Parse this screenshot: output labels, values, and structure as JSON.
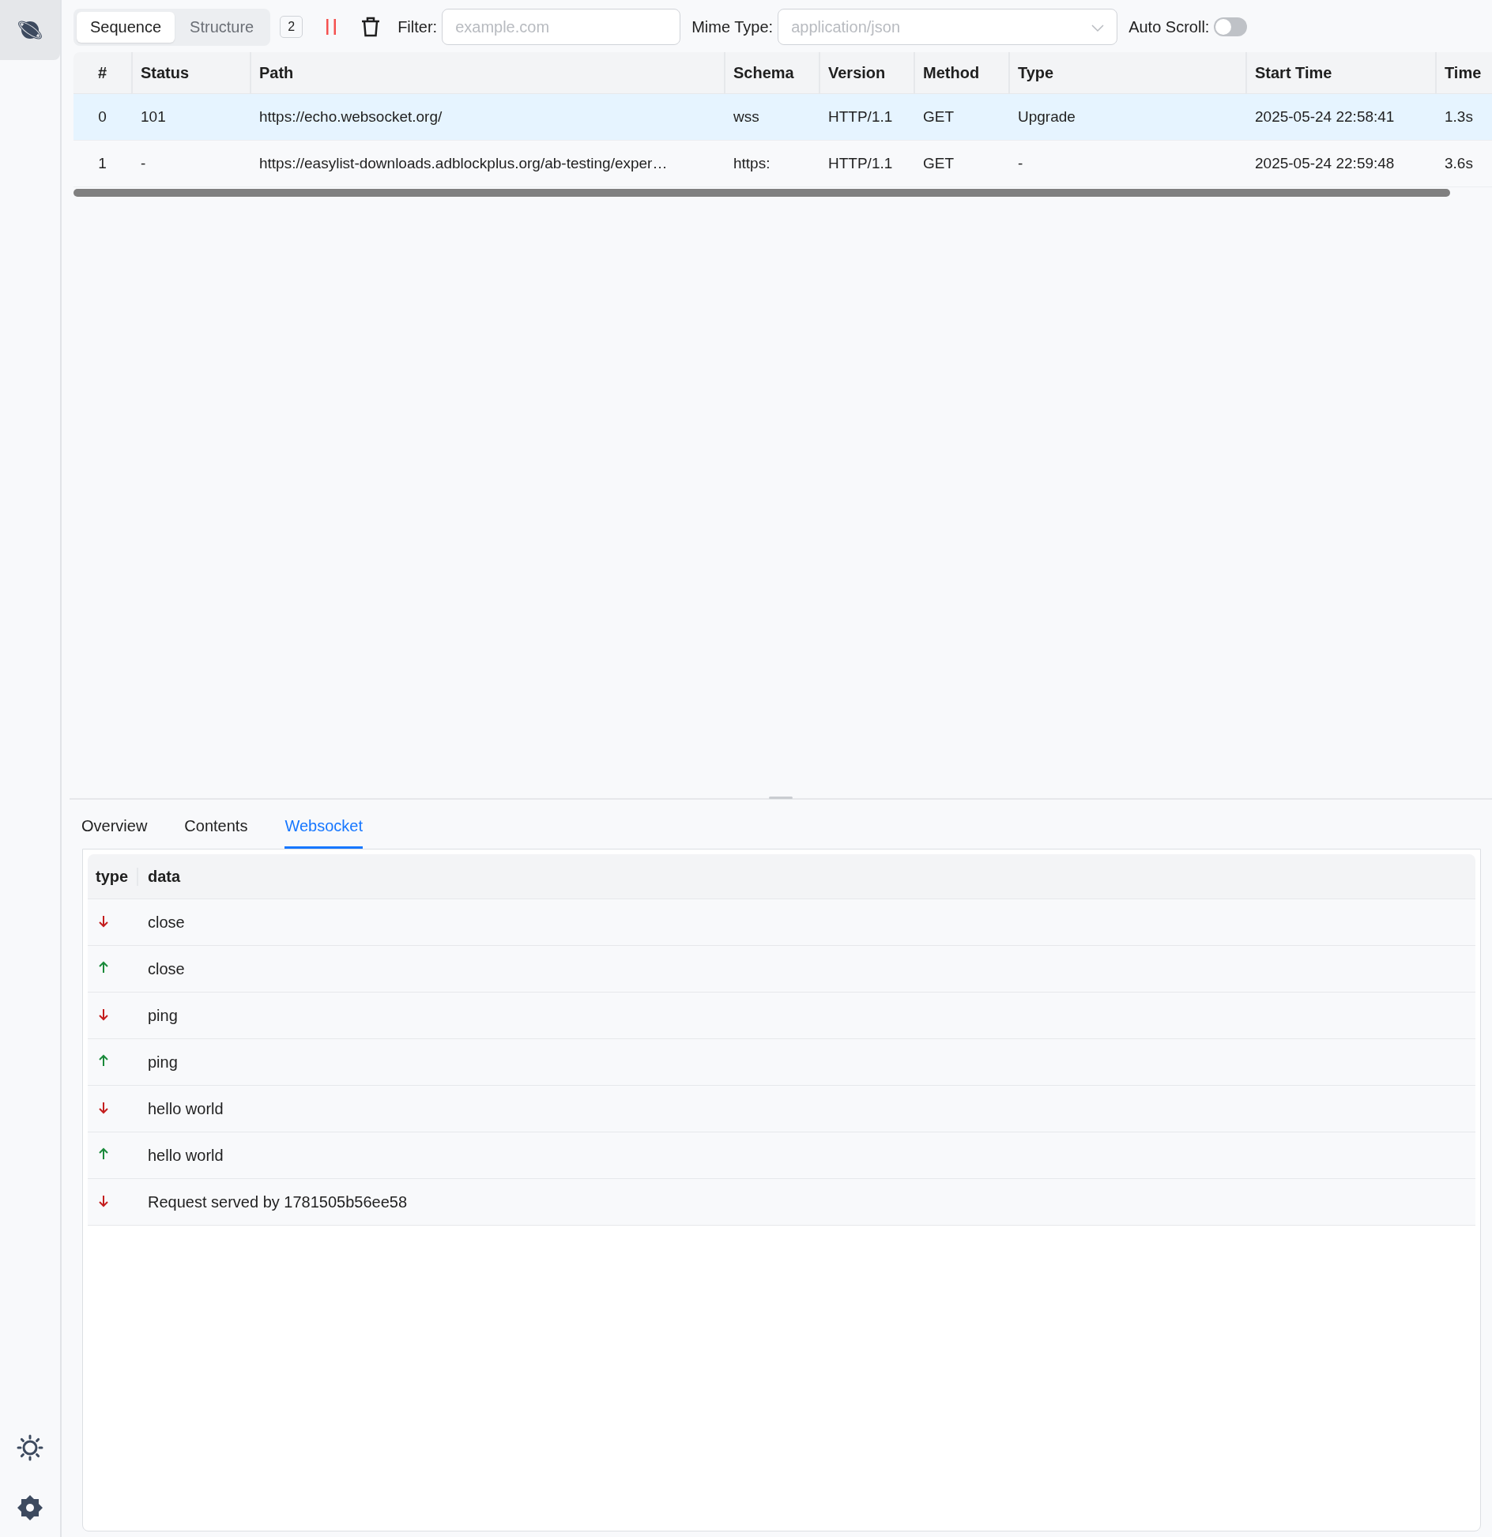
{
  "view_toggle": [
    {
      "label": "Sequence",
      "selected": true
    },
    {
      "label": "Structure",
      "selected": false
    }
  ],
  "request_count": "2",
  "filter": {
    "label": "Filter:",
    "placeholder": "example.com"
  },
  "mime_type": {
    "label": "Mime Type:",
    "placeholder": "application/json"
  },
  "auto_scroll": {
    "label": "Auto Scroll:",
    "on": false
  },
  "requests": {
    "columns": [
      "#",
      "Status",
      "Path",
      "Schema",
      "Version",
      "Method",
      "Type",
      "Start Time",
      "Time"
    ],
    "rows": [
      {
        "cells": [
          "0",
          "101",
          "https://echo.websocket.org/",
          "wss",
          "HTTP/1.1",
          "GET",
          "Upgrade",
          "2025-05-24 22:58:41",
          "1.3s"
        ],
        "selected": true
      },
      {
        "cells": [
          "1",
          "-",
          "https://easylist-downloads.adblockplus.org/ab-testing/exper…",
          "https:",
          "HTTP/1.1",
          "GET",
          "-",
          "2025-05-24 22:59:48",
          "3.6s"
        ],
        "selected": false
      }
    ]
  },
  "detail_tabs": [
    {
      "label": "Overview",
      "selected": false
    },
    {
      "label": "Contents",
      "selected": false
    },
    {
      "label": "Websocket",
      "selected": true
    }
  ],
  "websocket": {
    "columns": [
      "type",
      "data"
    ],
    "messages": [
      {
        "kind": "incoming",
        "data": "close"
      },
      {
        "kind": "outgoing",
        "data": "close"
      },
      {
        "kind": "incoming",
        "data": "ping"
      },
      {
        "kind": "outgoing",
        "data": "ping"
      },
      {
        "kind": "incoming",
        "data": "hello world"
      },
      {
        "kind": "outgoing",
        "data": "hello world"
      },
      {
        "kind": "incoming",
        "data": "Request served by 1781505b56ee58"
      }
    ]
  }
}
